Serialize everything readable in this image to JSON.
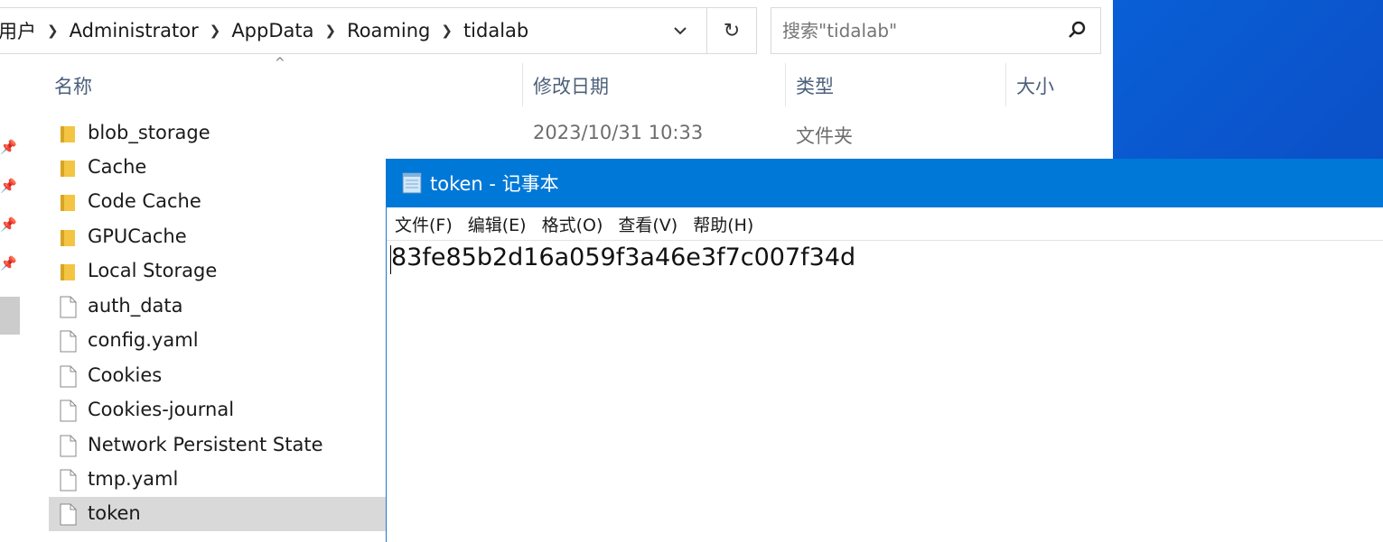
{
  "explorer": {
    "breadcrumb": [
      "用户",
      "Administrator",
      "AppData",
      "Roaming",
      "tidalab"
    ],
    "search_placeholder": "搜索\"tidalab\"",
    "columns": {
      "name": "名称",
      "date": "修改日期",
      "type": "类型",
      "size": "大小"
    },
    "files": [
      {
        "name": "blob_storage",
        "kind": "folder",
        "date": "2023/10/31 10:33",
        "type": "文件夹"
      },
      {
        "name": "Cache",
        "kind": "folder"
      },
      {
        "name": "Code Cache",
        "kind": "folder"
      },
      {
        "name": "GPUCache",
        "kind": "folder"
      },
      {
        "name": "Local Storage",
        "kind": "folder"
      },
      {
        "name": "auth_data",
        "kind": "file"
      },
      {
        "name": "config.yaml",
        "kind": "file"
      },
      {
        "name": "Cookies",
        "kind": "file"
      },
      {
        "name": "Cookies-journal",
        "kind": "file"
      },
      {
        "name": "Network Persistent State",
        "kind": "file"
      },
      {
        "name": "tmp.yaml",
        "kind": "file"
      },
      {
        "name": "token",
        "kind": "file",
        "selected": true
      }
    ]
  },
  "notepad": {
    "title": "token - 记事本",
    "menu": [
      "文件(F)",
      "编辑(E)",
      "格式(O)",
      "查看(V)",
      "帮助(H)"
    ],
    "content": "83fe85b2d16a059f3a46e3f7c007f34d"
  },
  "colors": {
    "titlebar": "#0078d7",
    "desktop": "#0b52c9",
    "folder": "#f4c542",
    "selection": "#d9d9d9"
  }
}
